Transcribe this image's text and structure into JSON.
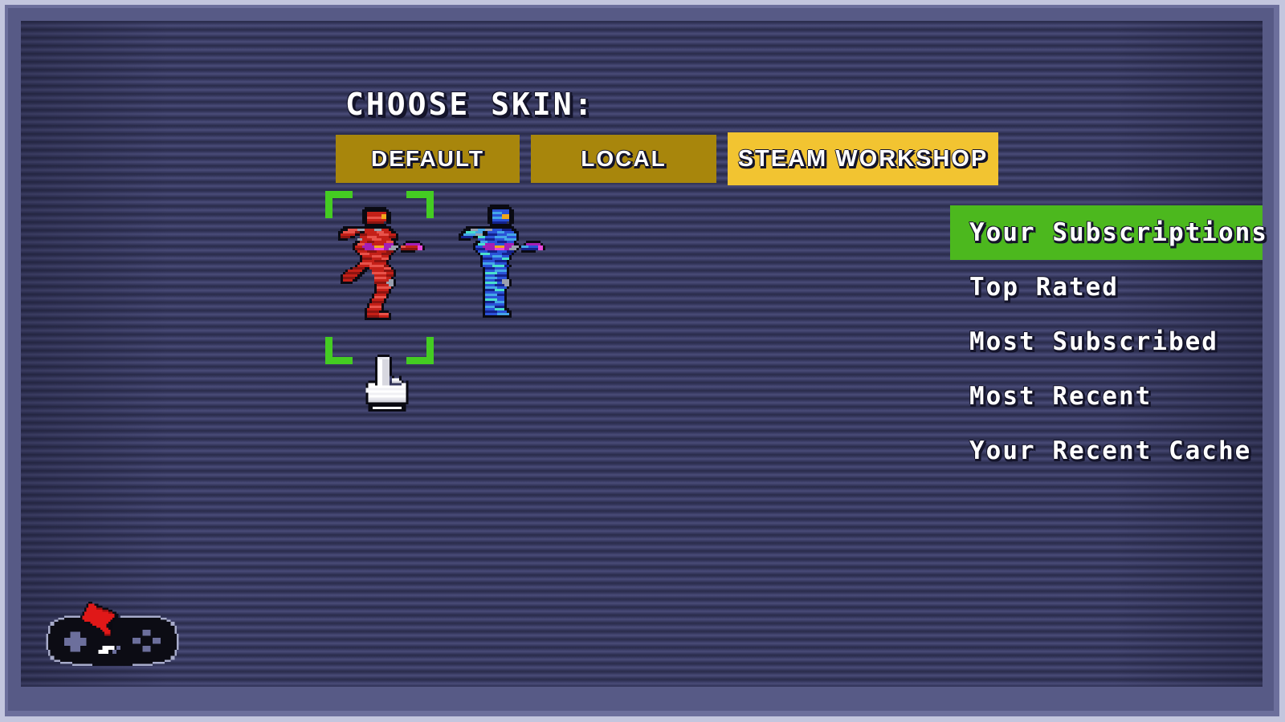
{
  "screen": {
    "title": "CHOOSE SKIN:",
    "frame_outer_color": "#c3c6de",
    "frame_mid_color": "#6c6f9c",
    "panel_color": "#2e3052"
  },
  "tabs": [
    {
      "id": "default",
      "label": "DEFAULT",
      "active": false,
      "color": "#a8860c"
    },
    {
      "id": "local",
      "label": "LOCAL",
      "active": false,
      "color": "#a8860c"
    },
    {
      "id": "steam-workshop",
      "label": "STEAM WORKSHOP",
      "active": true,
      "color": "#f2c431"
    }
  ],
  "preview": {
    "selection_bracket_color": "#44cc22",
    "selected_index": 0,
    "skins": [
      {
        "id": "skin-red",
        "name": "red-soldier-skin",
        "pose": "running",
        "selected": true,
        "palette": {
          "armor_dark": "#8d1410",
          "armor_mid": "#c42018",
          "armor_light": "#e8524a",
          "visor": "#f2a81c",
          "metal": "#9aa0ae",
          "weapon_a": "#a41fb6",
          "weapon_b": "#e845d8",
          "outline": "#0a0a12"
        }
      },
      {
        "id": "skin-blue",
        "name": "blue-soldier-skin",
        "pose": "idle",
        "selected": false,
        "palette": {
          "armor_dark": "#14228c",
          "armor_mid": "#2a52d8",
          "armor_light": "#44a6e8",
          "armor_cyan": "#4ae0cc",
          "visor": "#f2a81c",
          "metal": "#9aa0ae",
          "weapon_a": "#a41fb6",
          "weapon_b": "#e845d8",
          "outline": "#0a0a12"
        }
      }
    ],
    "cursor": {
      "name": "pointing-hand-cursor",
      "color": "#ffffff"
    }
  },
  "menu": {
    "highlight_color": "#4cb81e",
    "items": [
      {
        "label": "Your Subscriptions",
        "selected": true
      },
      {
        "label": "Top Rated",
        "selected": false
      },
      {
        "label": "Most Subscribed",
        "selected": false
      },
      {
        "label": "Most Recent",
        "selected": false
      },
      {
        "label": "Your Recent Cache",
        "selected": false
      }
    ]
  },
  "back_button": {
    "name": "back-gamepad-button",
    "arrow_color": "#e01818",
    "body_color": "#0c0c14",
    "accent_color": "#6c6f9c"
  }
}
